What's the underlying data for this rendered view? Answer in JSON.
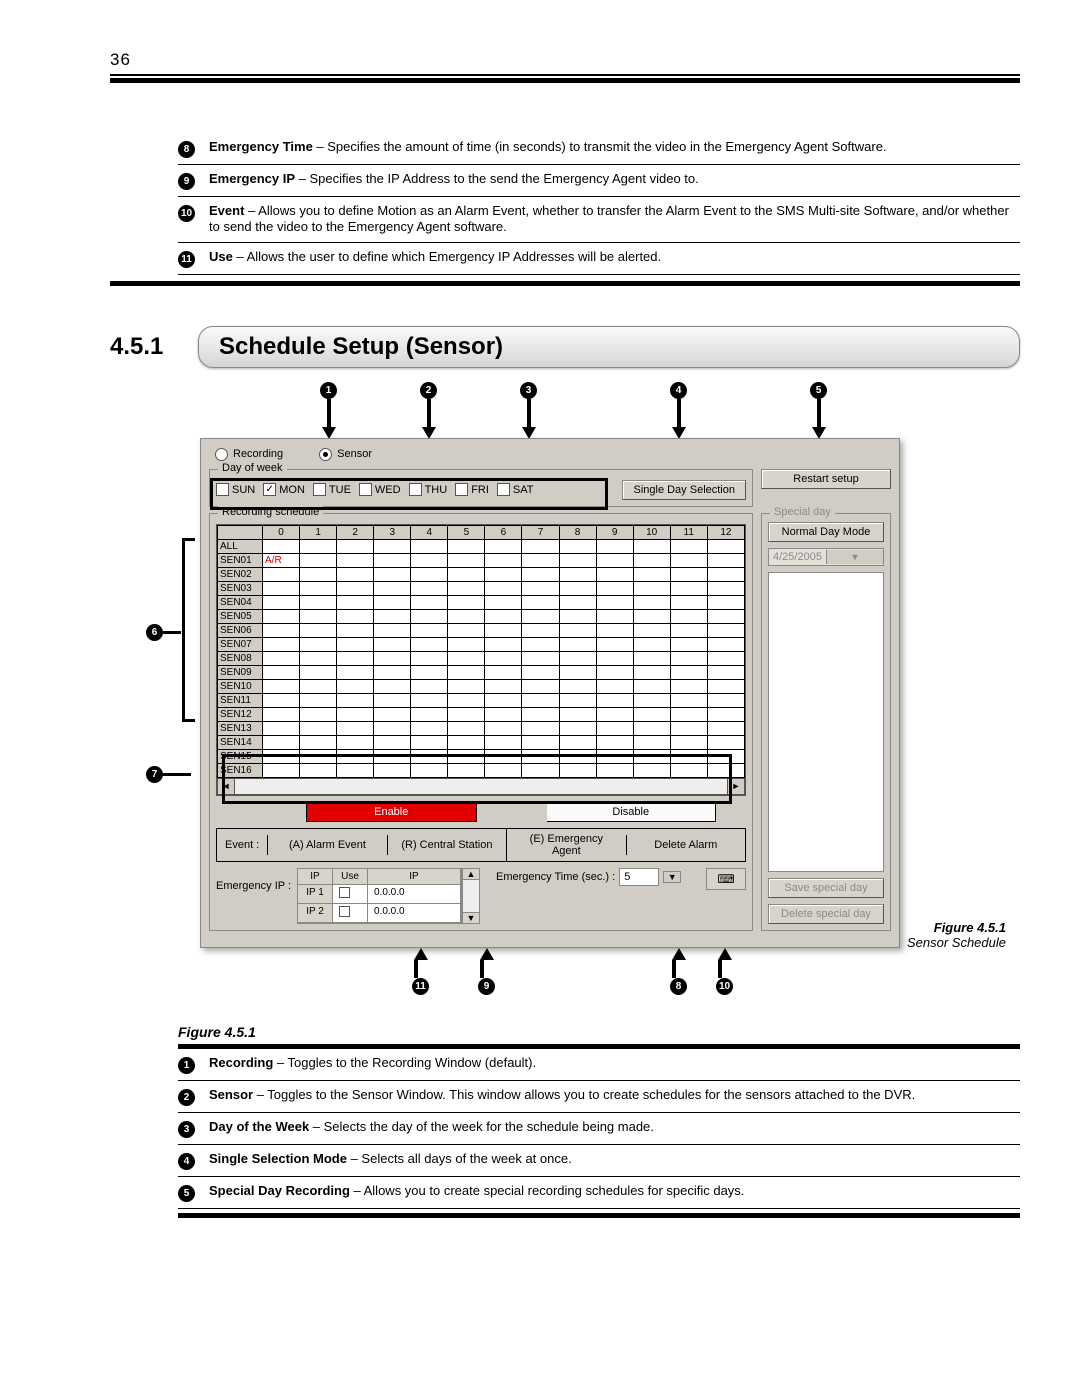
{
  "page_number": "36",
  "top_defs": [
    {
      "num": "8",
      "bold": "Emergency Time",
      "rest": " – Specifies the amount of time (in seconds) to transmit the video in the Emergency Agent Software."
    },
    {
      "num": "9",
      "bold": "Emergency IP",
      "rest": " – Specifies the IP Address to the send the Emergency Agent video to."
    },
    {
      "num": "10",
      "bold": "Event",
      "rest": " – Allows you to define Motion as an Alarm Event, whether to transfer the Alarm Event to the SMS Multi-site Software, and/or whether to send the video to the Emergency Agent software."
    },
    {
      "num": "11",
      "bold": "Use",
      "rest": " – Allows the user to define which Emergency IP Addresses will be alerted."
    }
  ],
  "section_number": "4.5.1",
  "section_title": "Schedule Setup (Sensor)",
  "callout_top": [
    "1",
    "2",
    "3",
    "4",
    "5"
  ],
  "callout_left": [
    "6",
    "7"
  ],
  "callout_bottom": [
    "11",
    "9",
    "8",
    "10"
  ],
  "figure": {
    "radios": {
      "recording": "Recording",
      "sensor": "Sensor"
    },
    "dow_legend": "Day of week",
    "days": [
      "SUN",
      "MON",
      "TUE",
      "WED",
      "THU",
      "FRI",
      "SAT"
    ],
    "day_checked": "MON",
    "single_day": "Single Day Selection",
    "restart": "Restart setup",
    "special_legend": "Special day",
    "normal_mode": "Normal Day Mode",
    "date": "4/25/2005",
    "save_special": "Save special day",
    "delete_special": "Delete special day",
    "rec_legend": "Recording schedule",
    "hours": [
      "0",
      "1",
      "2",
      "3",
      "4",
      "5",
      "6",
      "7",
      "8",
      "9",
      "10",
      "11",
      "12"
    ],
    "rows": [
      "ALL",
      "SEN01",
      "SEN02",
      "SEN03",
      "SEN04",
      "SEN05",
      "SEN06",
      "SEN07",
      "SEN08",
      "SEN09",
      "SEN10",
      "SEN11",
      "SEN12",
      "SEN13",
      "SEN14",
      "SEN15",
      "SEN16"
    ],
    "enable": "Enable",
    "disable": "Disable",
    "event_label": "Event :",
    "event_opts": [
      "(A) Alarm Event",
      "(R) Central Station",
      "(E) Emergency Agent",
      "Delete Alarm"
    ],
    "eip_label": "Emergency IP :",
    "ip_hdr": [
      "IP",
      "Use",
      "IP"
    ],
    "ip_rows": [
      {
        "name": "IP 1",
        "use": "",
        "addr": "0.0.0.0"
      },
      {
        "name": "IP 2",
        "use": "",
        "addr": "0.0.0.0"
      }
    ],
    "etime_label": "Emergency Time (sec.) :",
    "etime_val": "5"
  },
  "caption_fig": "Figure 4.5.1",
  "caption_name": "Sensor Schedule",
  "figure_ref": "Figure 4.5.1",
  "bottom_defs": [
    {
      "num": "1",
      "bold": "Recording",
      "rest": " – Toggles to the Recording Window (default)."
    },
    {
      "num": "2",
      "bold": "Sensor",
      "rest": " – Toggles to the Sensor Window. This window allows you to create schedules for the sensors attached to the DVR."
    },
    {
      "num": "3",
      "bold": "Day of the Week",
      "rest": " – Selects the day of the week for the schedule being made."
    },
    {
      "num": "4",
      "bold": "Single Selection Mode",
      "rest": " – Selects all days of the week at once."
    },
    {
      "num": "5",
      "bold": "Special Day Recording",
      "rest": " – Allows you to create special recording schedules for specific days."
    }
  ]
}
